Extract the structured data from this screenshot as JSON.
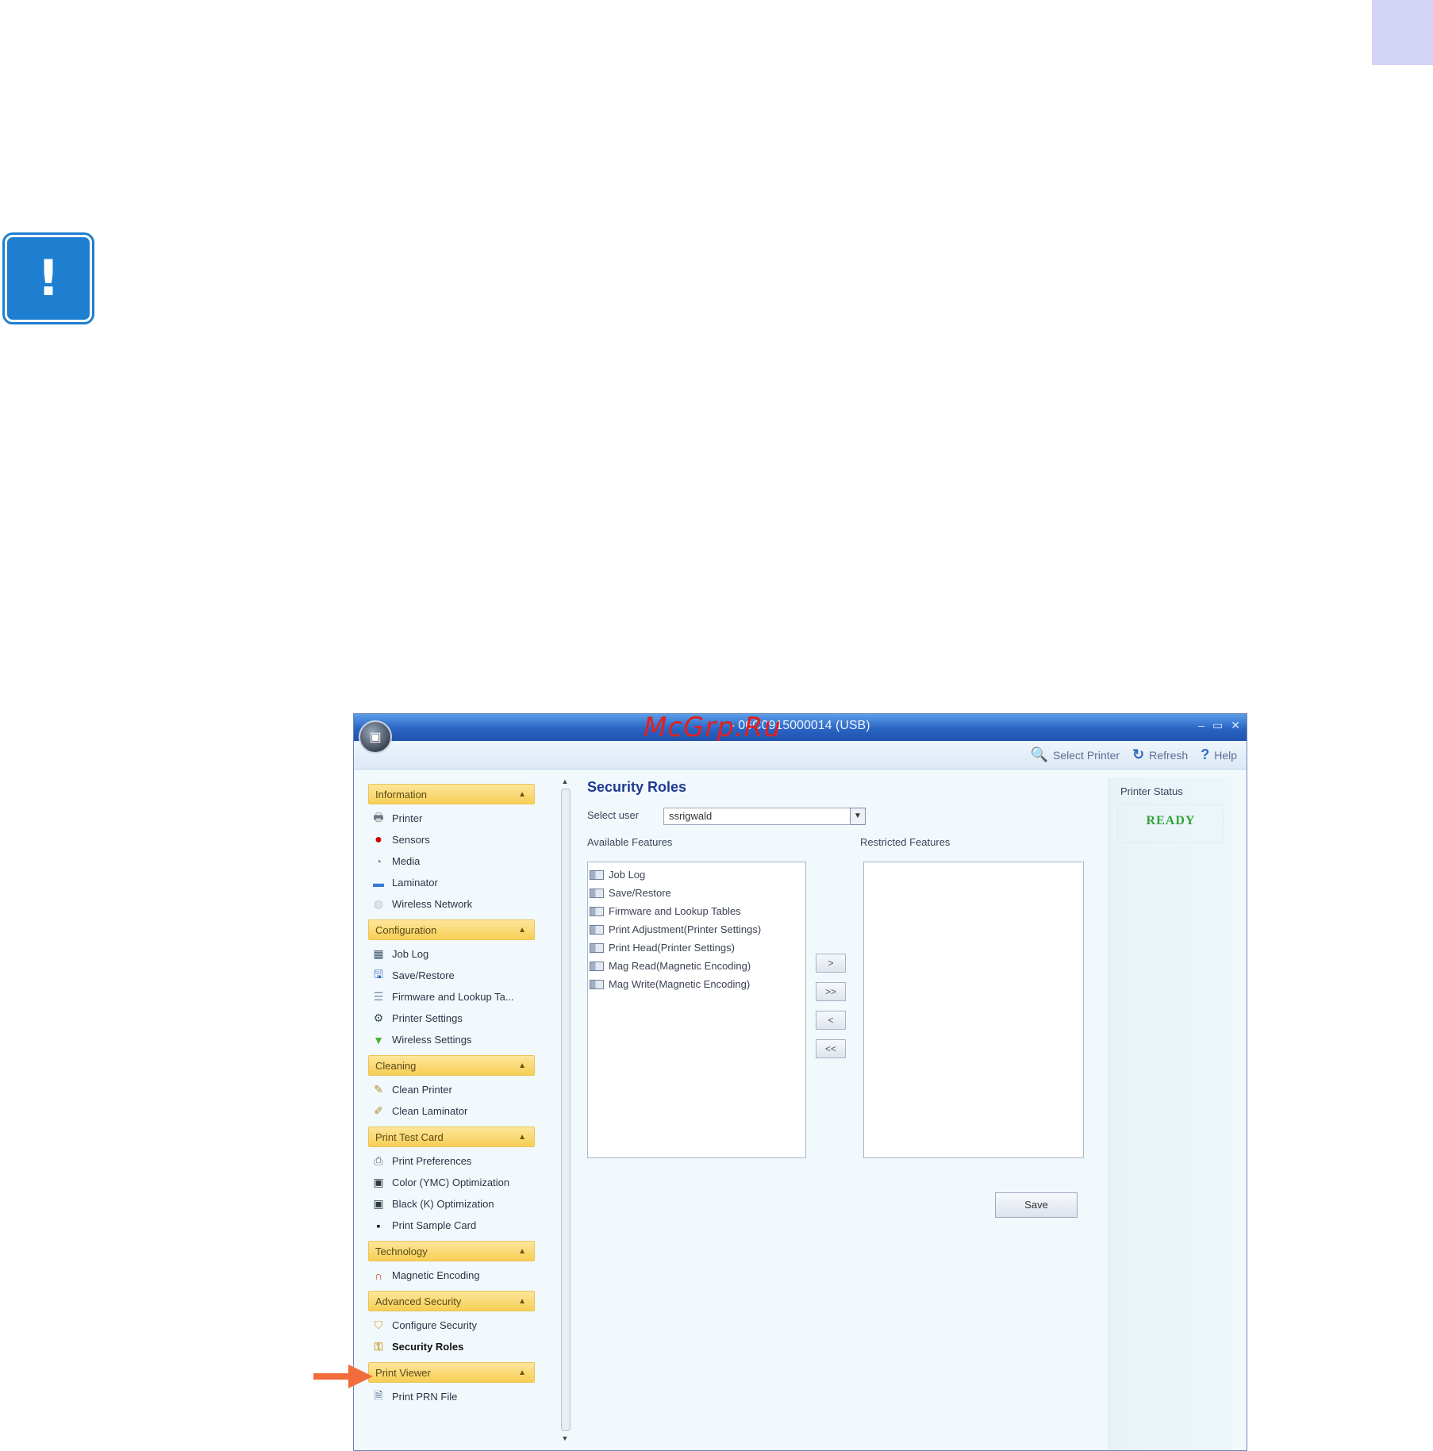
{
  "watermark": "McGrp.Ru",
  "window": {
    "title": "- 06C0915000014 (USB)",
    "controls": [
      "–",
      "▭",
      "✕"
    ]
  },
  "toolbar": {
    "select_printer": "Select Printer",
    "refresh": "Refresh",
    "help": "Help"
  },
  "sidebar": {
    "groups": [
      {
        "header": "Information",
        "items": [
          "Printer",
          "Sensors",
          "Media",
          "Laminator",
          "Wireless Network"
        ]
      },
      {
        "header": "Configuration",
        "items": [
          "Job Log",
          "Save/Restore",
          "Firmware and Lookup Ta...",
          "Printer Settings",
          "Wireless Settings"
        ]
      },
      {
        "header": "Cleaning",
        "items": [
          "Clean Printer",
          "Clean Laminator"
        ]
      },
      {
        "header": "Print Test Card",
        "items": [
          "Print Preferences",
          "Color (YMC) Optimization",
          "Black (K) Optimization",
          "Print Sample Card"
        ]
      },
      {
        "header": "Technology",
        "items": [
          "Magnetic Encoding"
        ]
      },
      {
        "header": "Advanced Security",
        "items": [
          "Configure Security",
          "Security Roles"
        ]
      },
      {
        "header": "Print Viewer",
        "items": [
          "Print PRN File"
        ]
      }
    ]
  },
  "security_roles": {
    "title": "Security Roles",
    "select_user_label": "Select user",
    "selected_user": "ssrigwald",
    "available_label": "Available Features",
    "restricted_label": "Restricted Features",
    "available_features": [
      "Job Log",
      "Save/Restore",
      "Firmware and Lookup Tables",
      "Print Adjustment(Printer Settings)",
      "Print Head(Printer Settings)",
      "Mag Read(Magnetic Encoding)",
      "Mag Write(Magnetic Encoding)"
    ],
    "restricted_features": [],
    "buttons": {
      "add": ">",
      "add_all": ">>",
      "remove": "<",
      "remove_all": "<<",
      "save": "Save"
    }
  },
  "printer_status": {
    "label": "Printer Status",
    "value": "READY"
  },
  "colors": {
    "status_ready": "#2fa43a",
    "accent_blue": "#1e7fd0",
    "arrow": "#f26b3a"
  }
}
